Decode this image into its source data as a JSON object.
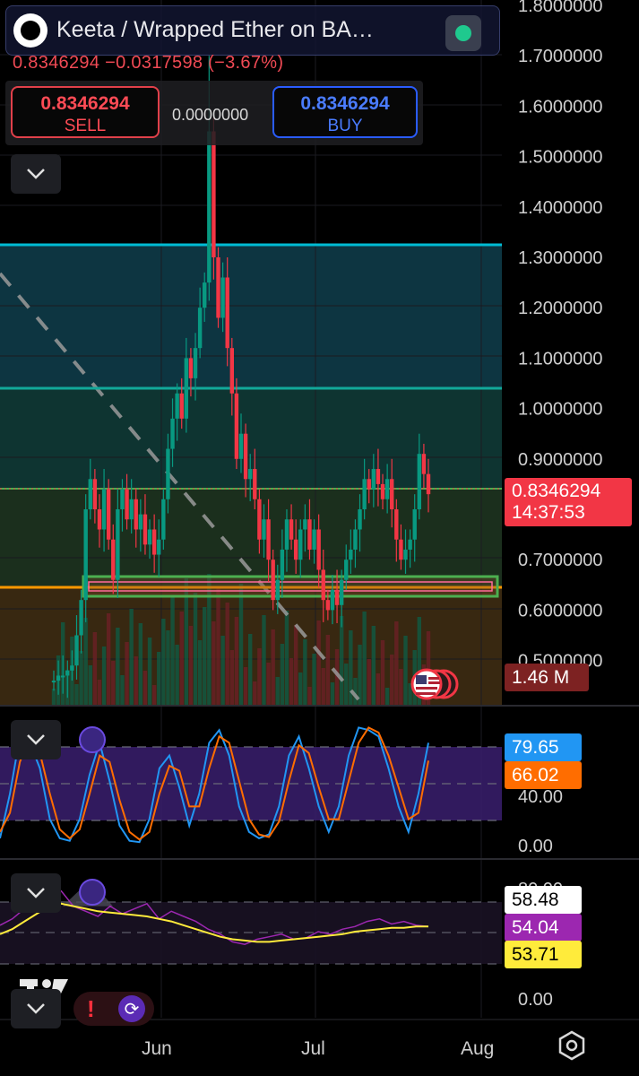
{
  "header": {
    "title": "Keeta / Wrapped Ether on BA…",
    "price_change": "0.8346294  −0.0317598 (−3.67%)",
    "status": "connected"
  },
  "trade": {
    "sell_price": "0.8346294",
    "sell_label": "SELL",
    "buy_price": "0.8346294",
    "buy_label": "BUY",
    "spread": "0.0000000"
  },
  "price_axis": {
    "labels": [
      "1.8000000",
      "1.7000000",
      "1.6000000",
      "1.5000000",
      "1.4000000",
      "1.3000000",
      "1.2000000",
      "1.1000000",
      "1.0000000",
      "0.9000000",
      "0.7000000",
      "0.6000000",
      "0.5000000"
    ]
  },
  "tags": {
    "last_price": "0.8346294",
    "countdown": "14:37:53",
    "volume": "1.46 M",
    "stoch_k": "79.65",
    "stoch_d": "66.02",
    "rsi_a": "58.48",
    "rsi_b": "54.04",
    "rsi_c": "53.71"
  },
  "stoch_axis": {
    "labels": [
      "40.00",
      "0.00"
    ]
  },
  "rsi_axis": {
    "labels": [
      "80.00",
      "0.00"
    ]
  },
  "time_axis": {
    "labels": [
      "Jun",
      "Jul",
      "Aug"
    ]
  },
  "colors": {
    "up": "#089981",
    "down": "#f23645",
    "fib_line_1": "#00bcd4",
    "fib_line_2": "#12a89a",
    "current_line": "#4caf50",
    "support_line": "#ff9800",
    "stoch_k": "#2196f3",
    "stoch_d": "#ff6d00",
    "rsi_line": "#9c27b0",
    "rsi_ma": "#ffeb3b"
  },
  "icons": {
    "logo": "keeta-logo-icon",
    "status": "live-status-icon",
    "collapse": "chevron-down-icon",
    "alert": "alert-icon",
    "sync": "sync-icon",
    "settings": "settings-hexagon-icon",
    "events": "us-flag-event-icon"
  }
}
